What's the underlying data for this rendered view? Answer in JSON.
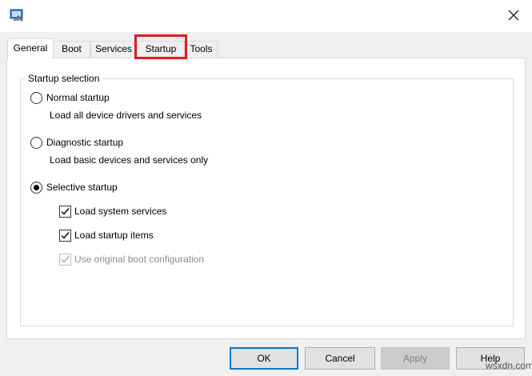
{
  "tabs": [
    {
      "label": "General",
      "selected": true
    },
    {
      "label": "Boot",
      "selected": false
    },
    {
      "label": "Services",
      "selected": false
    },
    {
      "label": "Startup",
      "selected": false,
      "highlighted": true
    },
    {
      "label": "Tools",
      "selected": false
    }
  ],
  "startup_selection": {
    "legend": "Startup selection",
    "options": [
      {
        "label": "Normal startup",
        "description": "Load all device drivers and services",
        "checked": false
      },
      {
        "label": "Diagnostic startup",
        "description": "Load basic devices and services only",
        "checked": false
      },
      {
        "label": "Selective startup",
        "checked": true
      }
    ],
    "selective_items": [
      {
        "label": "Load system services",
        "checked": true,
        "enabled": true
      },
      {
        "label": "Load startup items",
        "checked": true,
        "enabled": true
      },
      {
        "label": "Use original boot configuration",
        "checked": true,
        "enabled": false
      }
    ]
  },
  "buttons": {
    "ok": "OK",
    "cancel": "Cancel",
    "apply": "Apply",
    "help": "Help"
  },
  "watermark": "wsxdn.com",
  "colors": {
    "highlight": "#e11b22",
    "default_button_border": "#0078d7"
  },
  "icons": {
    "app": "msconfig-icon",
    "close": "close-icon"
  }
}
